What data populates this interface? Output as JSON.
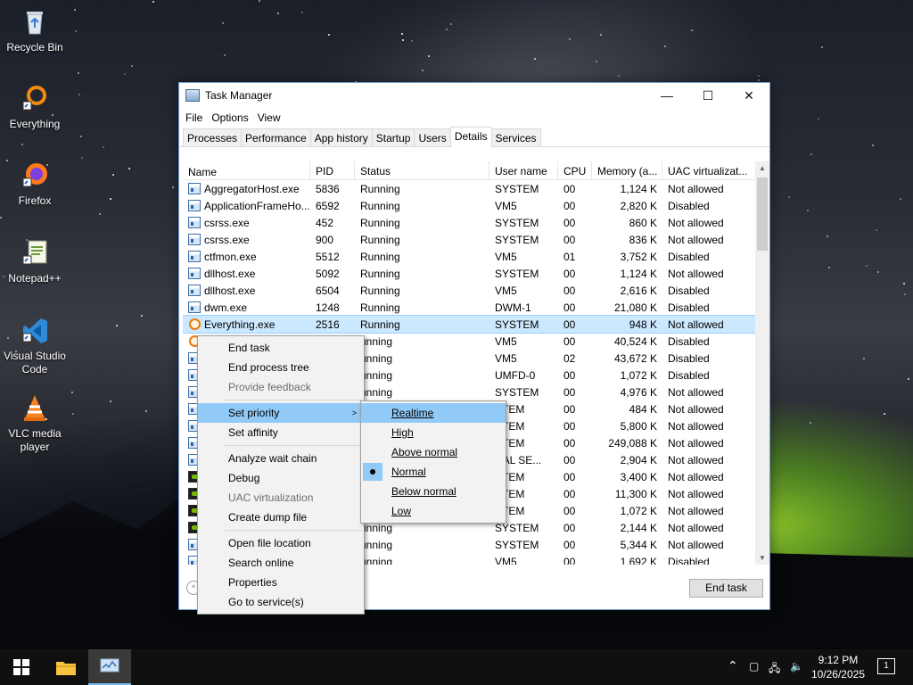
{
  "desktop": {
    "icons": [
      {
        "label": "Recycle Bin",
        "icon": "recycle-bin-icon"
      },
      {
        "label": "Everything",
        "icon": "everything-icon"
      },
      {
        "label": "Firefox",
        "icon": "firefox-icon"
      },
      {
        "label": "Notepad++",
        "icon": "notepad-plus-plus-icon"
      },
      {
        "label": "Visual Studio Code",
        "icon": "vscode-icon"
      },
      {
        "label": "VLC media player",
        "icon": "vlc-icon"
      }
    ]
  },
  "window": {
    "title": "Task Manager",
    "controls": {
      "minimize": "—",
      "maximize": "☐",
      "close": "✕"
    },
    "menu": [
      "File",
      "Options",
      "View"
    ],
    "tabs": [
      "Processes",
      "Performance",
      "App history",
      "Startup",
      "Users",
      "Details",
      "Services"
    ],
    "active_tab": "Details",
    "columns": [
      "Name",
      "PID",
      "Status",
      "User name",
      "CPU",
      "Memory (a...",
      "UAC virtualizat..."
    ],
    "rows": [
      {
        "name": "AggregatorHost.exe",
        "pid": "5836",
        "status": "Running",
        "user": "SYSTEM",
        "cpu": "00",
        "mem": "1,124 K",
        "uac": "Not allowed",
        "icon": "app"
      },
      {
        "name": "ApplicationFrameHo...",
        "pid": "6592",
        "status": "Running",
        "user": "VM5",
        "cpu": "00",
        "mem": "2,820 K",
        "uac": "Disabled",
        "icon": "app"
      },
      {
        "name": "csrss.exe",
        "pid": "452",
        "status": "Running",
        "user": "SYSTEM",
        "cpu": "00",
        "mem": "860 K",
        "uac": "Not allowed",
        "icon": "app"
      },
      {
        "name": "csrss.exe",
        "pid": "900",
        "status": "Running",
        "user": "SYSTEM",
        "cpu": "00",
        "mem": "836 K",
        "uac": "Not allowed",
        "icon": "app"
      },
      {
        "name": "ctfmon.exe",
        "pid": "5512",
        "status": "Running",
        "user": "VM5",
        "cpu": "01",
        "mem": "3,752 K",
        "uac": "Disabled",
        "icon": "app"
      },
      {
        "name": "dllhost.exe",
        "pid": "5092",
        "status": "Running",
        "user": "SYSTEM",
        "cpu": "00",
        "mem": "1,124 K",
        "uac": "Not allowed",
        "icon": "app"
      },
      {
        "name": "dllhost.exe",
        "pid": "6504",
        "status": "Running",
        "user": "VM5",
        "cpu": "00",
        "mem": "2,616 K",
        "uac": "Disabled",
        "icon": "app"
      },
      {
        "name": "dwm.exe",
        "pid": "1248",
        "status": "Running",
        "user": "DWM-1",
        "cpu": "00",
        "mem": "21,080 K",
        "uac": "Disabled",
        "icon": "app"
      },
      {
        "name": "Everything.exe",
        "pid": "2516",
        "status": "Running",
        "user": "SYSTEM",
        "cpu": "00",
        "mem": "948 K",
        "uac": "Not allowed",
        "icon": "everything",
        "selected": true
      },
      {
        "name": "",
        "pid": "",
        "status": "unning",
        "user": "VM5",
        "cpu": "00",
        "mem": "40,524 K",
        "uac": "Disabled",
        "icon": "everything"
      },
      {
        "name": "",
        "pid": "",
        "status": "unning",
        "user": "VM5",
        "cpu": "02",
        "mem": "43,672 K",
        "uac": "Disabled",
        "icon": "app"
      },
      {
        "name": "",
        "pid": "",
        "status": "unning",
        "user": "UMFD-0",
        "cpu": "00",
        "mem": "1,072 K",
        "uac": "Disabled",
        "icon": "app"
      },
      {
        "name": "",
        "pid": "",
        "status": "unning",
        "user": "SYSTEM",
        "cpu": "00",
        "mem": "4,976 K",
        "uac": "Not allowed",
        "icon": "app"
      },
      {
        "name": "",
        "pid": "",
        "status": "",
        "user": "STEM",
        "cpu": "00",
        "mem": "484 K",
        "uac": "Not allowed",
        "icon": "app"
      },
      {
        "name": "",
        "pid": "",
        "status": "",
        "user": "STEM",
        "cpu": "00",
        "mem": "5,800 K",
        "uac": "Not allowed",
        "icon": "app"
      },
      {
        "name": "",
        "pid": "",
        "status": "",
        "user": "STEM",
        "cpu": "00",
        "mem": "249,088 K",
        "uac": "Not allowed",
        "icon": "app"
      },
      {
        "name": "",
        "pid": "",
        "status": "",
        "user": "CAL SE...",
        "cpu": "00",
        "mem": "2,904 K",
        "uac": "Not allowed",
        "icon": "app"
      },
      {
        "name": "",
        "pid": "",
        "status": "",
        "user": "STEM",
        "cpu": "00",
        "mem": "3,400 K",
        "uac": "Not allowed",
        "icon": "nv"
      },
      {
        "name": "",
        "pid": "",
        "status": "",
        "user": "STEM",
        "cpu": "00",
        "mem": "11,300 K",
        "uac": "Not allowed",
        "icon": "nv"
      },
      {
        "name": "",
        "pid": "",
        "status": "",
        "user": "STEM",
        "cpu": "00",
        "mem": "1,072 K",
        "uac": "Not allowed",
        "icon": "nv"
      },
      {
        "name": "",
        "pid": "",
        "status": "unning",
        "user": "SYSTEM",
        "cpu": "00",
        "mem": "2,144 K",
        "uac": "Not allowed",
        "icon": "nv"
      },
      {
        "name": "",
        "pid": "",
        "status": "unning",
        "user": "SYSTEM",
        "cpu": "00",
        "mem": "5,344 K",
        "uac": "Not allowed",
        "icon": "app"
      },
      {
        "name": "",
        "pid": "",
        "status": "unning",
        "user": "VM5",
        "cpu": "00",
        "mem": "1,692 K",
        "uac": "Disabled",
        "icon": "app"
      }
    ],
    "end_task_label": "End task"
  },
  "context_menu": {
    "items": [
      {
        "label": "End task",
        "type": "item"
      },
      {
        "label": "End process tree",
        "type": "item"
      },
      {
        "label": "Provide feedback",
        "type": "disabled"
      },
      {
        "type": "sep"
      },
      {
        "label": "Set priority",
        "type": "submenu",
        "highlight": true
      },
      {
        "label": "Set affinity",
        "type": "item"
      },
      {
        "type": "sep"
      },
      {
        "label": "Analyze wait chain",
        "type": "item"
      },
      {
        "label": "Debug",
        "type": "item"
      },
      {
        "label": "UAC virtualization",
        "type": "disabled"
      },
      {
        "label": "Create dump file",
        "type": "item"
      },
      {
        "type": "sep"
      },
      {
        "label": "Open file location",
        "type": "item"
      },
      {
        "label": "Search online",
        "type": "item"
      },
      {
        "label": "Properties",
        "type": "item"
      },
      {
        "label": "Go to service(s)",
        "type": "item"
      }
    ]
  },
  "priority_menu": {
    "items": [
      {
        "label": "Realtime",
        "highlight": true
      },
      {
        "label": "High"
      },
      {
        "label": "Above normal"
      },
      {
        "label": "Normal",
        "checked": true
      },
      {
        "label": "Below normal"
      },
      {
        "label": "Low"
      }
    ]
  },
  "taskbar": {
    "time": "9:12 PM",
    "date": "10/26/2025",
    "notification_count": "1"
  }
}
